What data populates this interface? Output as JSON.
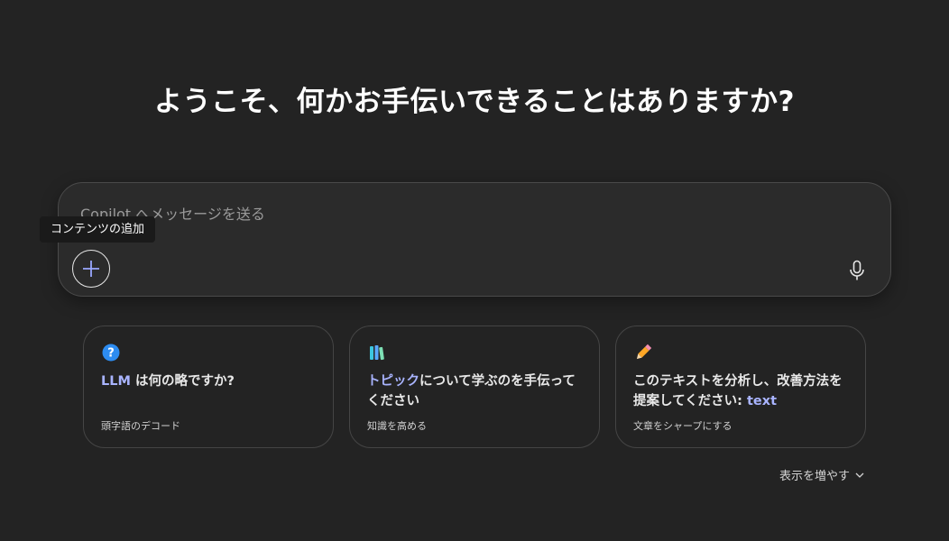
{
  "headline": "ようこそ、何かお手伝いできることはありますか?",
  "composer": {
    "placeholder": "Copilot へメッセージを送る",
    "add_tooltip": "コンテンツの追加"
  },
  "cards": [
    {
      "icon": "question-icon",
      "title_hl": "LLM",
      "title_rest": " は何の略ですか?",
      "sub": "頭字語のデコード"
    },
    {
      "icon": "books-icon",
      "title_hl": "トピック",
      "title_rest": "について学ぶのを手伝ってください",
      "sub": "知識を高める"
    },
    {
      "icon": "pencil-icon",
      "title_pre": "このテキストを分析し、改善方法を提案してください: ",
      "title_hl": "text",
      "sub": "文章をシャープにする"
    }
  ],
  "show_more": "表示を増やす",
  "colors": {
    "background": "#232323",
    "accent": "#a9b4ff",
    "question": "#2d8cf0"
  }
}
